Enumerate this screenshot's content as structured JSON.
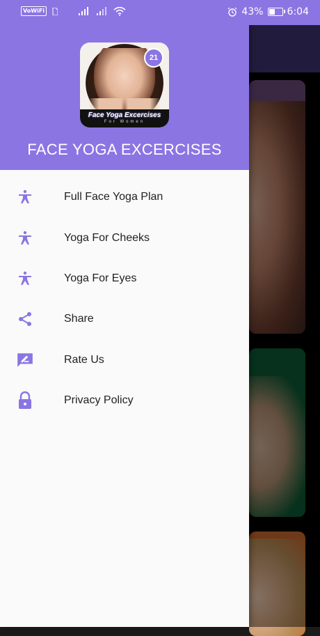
{
  "status_bar": {
    "network_tag": "VoWiFi",
    "battery_percent": "43%",
    "time": "6:04",
    "icons": [
      "vowifi-icon",
      "sim-icon",
      "signal-icon",
      "signal-icon",
      "wifi-icon",
      "alarm-icon",
      "battery-icon"
    ]
  },
  "drawer": {
    "header": {
      "logo": {
        "badge": "21",
        "banner_line1": "Face Yoga Excercises",
        "banner_line2": "For Women"
      },
      "title": "FACE YOGA EXCERCISES"
    },
    "items": [
      {
        "label": "Full Face Yoga Plan",
        "icon": "yoga-pose-icon"
      },
      {
        "label": "Yoga For Cheeks",
        "icon": "yoga-pose-icon"
      },
      {
        "label": "Yoga For Eyes",
        "icon": "yoga-pose-icon"
      },
      {
        "label": "Share",
        "icon": "share-icon"
      },
      {
        "label": "Rate Us",
        "icon": "rate-review-icon"
      },
      {
        "label": "Privacy Policy",
        "icon": "lock-icon"
      }
    ]
  },
  "colors": {
    "primary": "#8b75e3",
    "icon": "#8b75e3",
    "drawer_bg": "#fafafa",
    "text": "#222222"
  }
}
